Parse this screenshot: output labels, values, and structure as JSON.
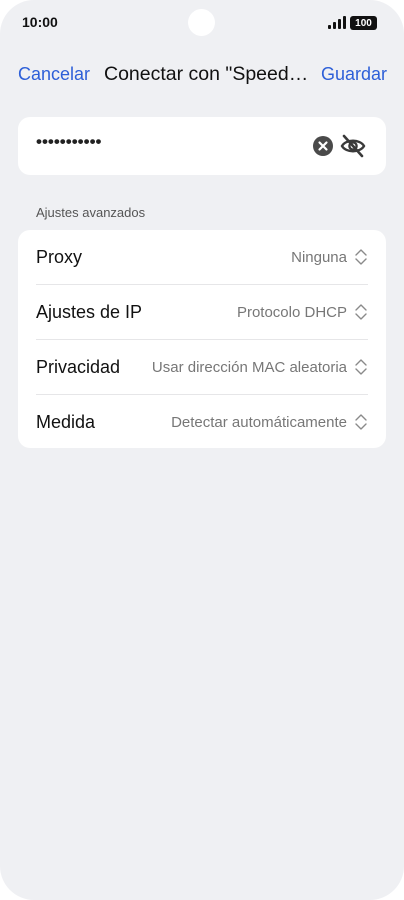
{
  "status_bar": {
    "time": "10:00",
    "battery": "100"
  },
  "header": {
    "cancel_label": "Cancelar",
    "title": "Conectar con \"Speedport\"",
    "save_label": "Guardar"
  },
  "password": {
    "value": "•••••••••••"
  },
  "advanced": {
    "section_label": "Ajustes avanzados",
    "rows": [
      {
        "label": "Proxy",
        "value": "Ninguna"
      },
      {
        "label": "Ajustes de IP",
        "value": "Protocolo DHCP"
      },
      {
        "label": "Privacidad",
        "value": "Usar dirección MAC aleatoria"
      },
      {
        "label": "Medida",
        "value": "Detectar automáticamente"
      }
    ]
  },
  "colors": {
    "accent": "#2d5fd8",
    "background": "#eff0f3",
    "card": "#ffffff"
  }
}
